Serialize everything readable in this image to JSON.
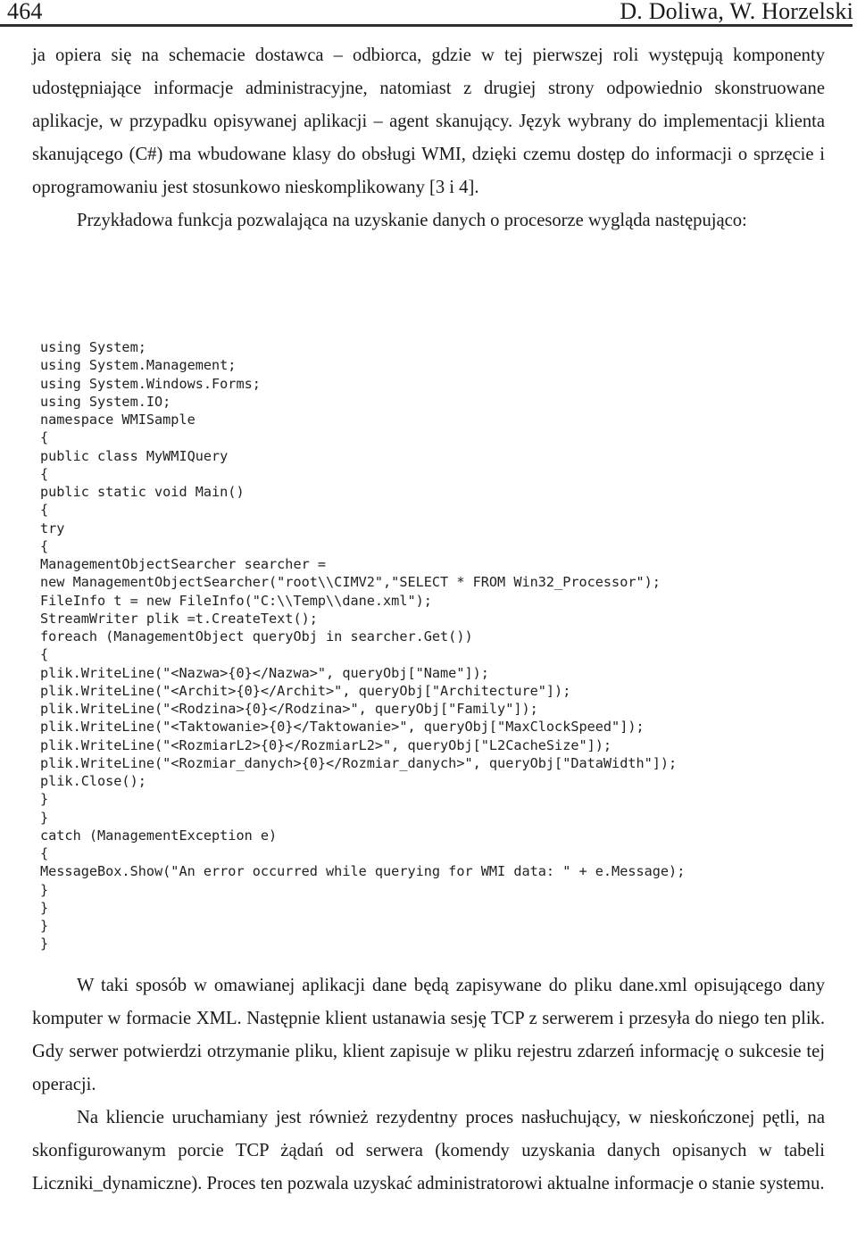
{
  "header": {
    "folio": "464",
    "authors": "D. Doliwa, W. Horzelski"
  },
  "body": {
    "paragraph_1": "ja opiera się na schemacie dostawca – odbiorca, gdzie w tej pierwszej roli występują komponenty udostępniające informacje administracyjne, natomiast z drugiej strony odpowiednio skonstruowane aplikacje, w przypadku opisywanej aplikacji – agent skanujący. Język wybrany do implementacji klienta skanującego (C#) ma wbudowane klasy do obsługi WMI, dzięki czemu dostęp do informacji o sprzęcie i oprogramowaniu jest stosunkowo nieskomplikowany [3 i 4].",
    "paragraph_2": "Przykładowa funkcja pozwalająca na uzyskanie danych o procesorze wygląda następująco:",
    "paragraph_3": "W taki sposób w omawianej aplikacji dane będą zapisywane do pliku dane.xml opisującego dany komputer w formacie XML. Następnie klient ustanawia sesję TCP z serwerem i przesyła do niego ten plik. Gdy serwer potwierdzi otrzymanie pliku, klient zapisuje w pliku rejestru zdarzeń informację o sukcesie tej operacji.",
    "paragraph_4": "Na kliencie uruchamiany jest również rezydentny proces nasłuchujący, w nieskończonej pętli, na skonfigurowanym porcie TCP żądań od serwera (komendy uzyskania danych opisanych w tabeli Liczniki_dynamiczne). Proces ten pozwala uzyskać administratorowi aktualne informacje o stanie systemu."
  },
  "code_listing": {
    "language": "C#",
    "lines": [
      "using System;",
      "using System.Management;",
      "using System.Windows.Forms;",
      "using System.IO;",
      "namespace WMISample",
      "{",
      "public class MyWMIQuery",
      "{",
      "public static void Main()",
      "{",
      "try",
      "{",
      "ManagementObjectSearcher searcher =",
      "new ManagementObjectSearcher(\"root\\\\CIMV2\",\"SELECT * FROM Win32_Processor\");",
      "FileInfo t = new FileInfo(\"C:\\\\Temp\\\\dane.xml\");",
      "StreamWriter plik =t.CreateText();",
      "foreach (ManagementObject queryObj in searcher.Get())",
      "{",
      "plik.WriteLine(\"<Nazwa>{0}</Nazwa>\", queryObj[\"Name\"]);",
      "plik.WriteLine(\"<Archit>{0}</Archit>\", queryObj[\"Architecture\"]);",
      "plik.WriteLine(\"<Rodzina>{0}</Rodzina>\", queryObj[\"Family\"]);",
      "plik.WriteLine(\"<Taktowanie>{0}</Taktowanie>\", queryObj[\"MaxClockSpeed\"]);",
      "plik.WriteLine(\"<RozmiarL2>{0}</RozmiarL2>\", queryObj[\"L2CacheSize\"]);",
      "plik.WriteLine(\"<Rozmiar_danych>{0}</Rozmiar_danych>\", queryObj[\"DataWidth\"]);",
      "plik.Close();",
      "}",
      "}",
      "catch (ManagementException e)",
      "{",
      "MessageBox.Show(\"An error occurred while querying for WMI data: \" + e.Message);",
      "}",
      "}",
      "}",
      "}"
    ]
  }
}
